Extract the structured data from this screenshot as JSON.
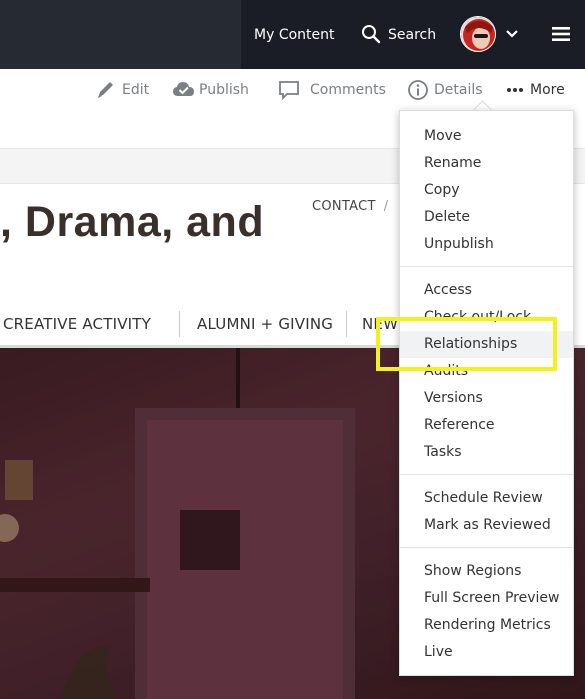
{
  "topbar": {
    "my_content": "My Content",
    "search": "Search"
  },
  "toolbar": {
    "edit": "Edit",
    "publish": "Publish",
    "comments": "Comments",
    "details": "Details",
    "more": "More"
  },
  "page": {
    "headline": ", Drama, and",
    "utility_contact": "CONTACT",
    "utility_sep": "/",
    "nav": [
      "CREATIVE ACTIVITY",
      "ALUMNI + GIVING",
      "NEW"
    ]
  },
  "menu": {
    "group1": [
      "Move",
      "Rename",
      "Copy",
      "Delete",
      "Unpublish"
    ],
    "group2": [
      "Access",
      "Check out/Lock",
      "Relationships",
      "Audits",
      "Versions",
      "Reference",
      "Tasks"
    ],
    "group3": [
      "Schedule Review",
      "Mark as Reviewed"
    ],
    "group4": [
      "Show Regions",
      "Full Screen Preview",
      "Rendering Metrics",
      "Live"
    ]
  },
  "colors": {
    "topbar": "#262a33",
    "highlight": "#f3f01a"
  }
}
